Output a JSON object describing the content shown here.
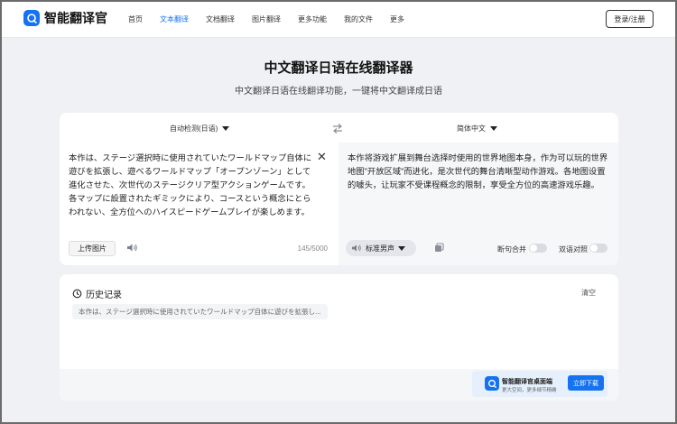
{
  "header": {
    "logo_text": "智能翻译官",
    "nav": [
      "首页",
      "文本翻译",
      "文档翻译",
      "图片翻译",
      "更多功能",
      "我的文件",
      "更多"
    ],
    "active_index": 1,
    "login_label": "登录/注册"
  },
  "hero": {
    "title": "中文翻译日语在线翻译器",
    "subtitle": "中文翻译日语在线翻译功能，一键将中文翻译成日语"
  },
  "translator": {
    "source_lang": "自动检测(日语)",
    "target_lang": "简体中文",
    "source_text": "本作は、ステージ選択時に使用されていたワールドマップ自体に遊びを拡張し、遊べるワールドマップ「オープンゾーン」として進化させた、次世代のステージクリア型アクションゲームです。各マップに設置されたギミックにより、コースという概念にとらわれない、全方位へのハイスピードゲームプレイが楽しめます。",
    "target_text": "本作将游戏扩展到舞台选择时使用的世界地图本身，作为可以玩的世界地图\"开放区域\"而进化，是次世代的舞台清晰型动作游戏。各地图设置的噱头，让玩家不受课程概念的限制，享受全方位的高速游戏乐趣。",
    "upload_label": "上传图片",
    "char_count": "145/5000",
    "voice_label": "标准男声",
    "toggle_break": "断句合并",
    "toggle_compare": "双语对照"
  },
  "history": {
    "title": "历史记录",
    "clear_label": "清空",
    "items": [
      "本作は、ステージ選択時に使用されていたワールドマップ自体に遊びを拡張し..."
    ]
  },
  "promo": {
    "title": "智能翻译官桌面端",
    "subtitle": "更大空间，更多细节精确",
    "button": "立即下载"
  },
  "colors": {
    "accent": "#1673f0",
    "background": "#f0f1f4"
  }
}
